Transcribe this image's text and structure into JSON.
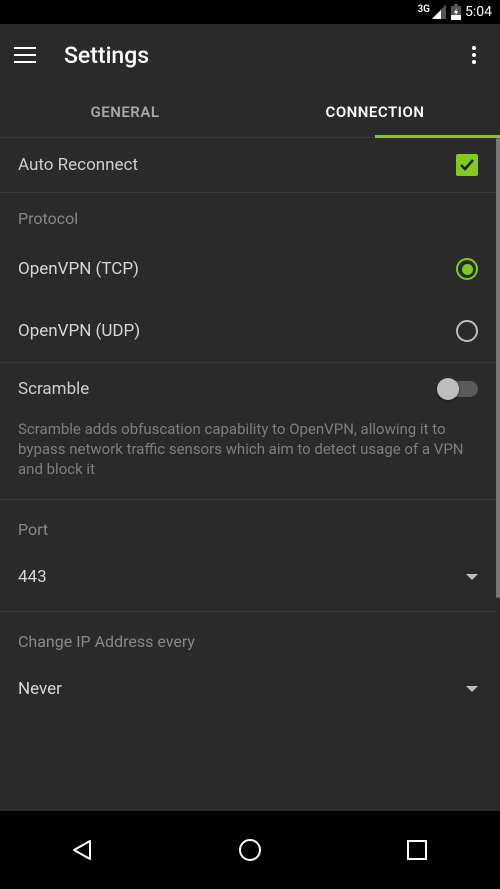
{
  "status": {
    "network": "3G",
    "time": "5:04"
  },
  "app_bar": {
    "title": "Settings"
  },
  "tabs": {
    "general": "GENERAL",
    "connection": "CONNECTION",
    "active": "connection"
  },
  "colors": {
    "accent": "#7fcc1f"
  },
  "settings": {
    "auto_reconnect": {
      "label": "Auto Reconnect",
      "checked": true
    },
    "protocol": {
      "header": "Protocol",
      "tcp": {
        "label": "OpenVPN (TCP)",
        "selected": true
      },
      "udp": {
        "label": "OpenVPN (UDP)",
        "selected": false
      }
    },
    "scramble": {
      "label": "Scramble",
      "enabled": false,
      "description": "Scramble adds obfuscation capability to OpenVPN, allowing it to bypass network traffic sensors which aim to detect usage of a VPN and block it"
    },
    "port": {
      "header": "Port",
      "value": "443"
    },
    "ip_change": {
      "header": "Change IP Address every",
      "value": "Never"
    }
  }
}
